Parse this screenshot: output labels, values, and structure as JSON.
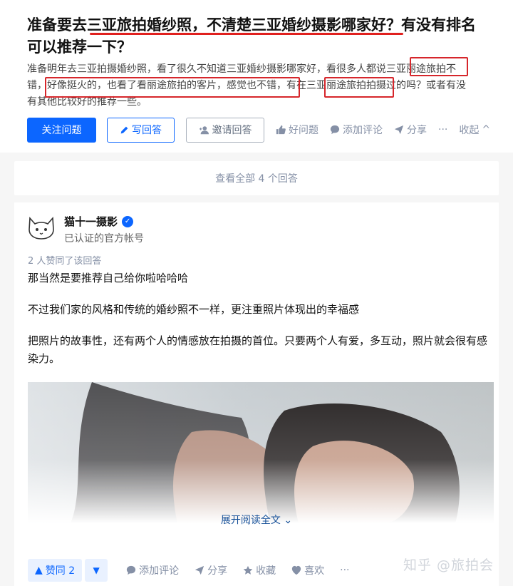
{
  "question": {
    "title_line1": "准备要去三亚旅拍婚纱照，不清楚三亚婚纱摄影哪家好？有没有排名",
    "title_line2": "可以推荐一下？",
    "desc_line1": "准备明年去三亚拍摄婚纱照，看了很久不知道三亚婚纱摄影哪家好，看很多人都说三亚丽途旅拍不",
    "desc_line2": "错，好像挺火的，也看了看丽途旅拍的客片，感觉也不错，有在三亚丽途旅拍拍摄过的吗？或者有没",
    "desc_line3": "有其他比较好的推荐一些。"
  },
  "actions": {
    "follow": "关注问题",
    "write": "写回答",
    "invite": "邀请回答",
    "good": "好问题",
    "comment": "添加评论",
    "share": "分享",
    "more": "···",
    "collapse": "收起"
  },
  "all_answers": "查看全部 4 个回答",
  "answer": {
    "author": "猫十一摄影",
    "bio": "已认证的官方帐号",
    "votes_text": "2 人赞同了该回答",
    "paragraphs": [
      "那当然是要推荐自己给你啦哈哈哈",
      "不过我们家的风格和传统的婚纱照不一样，更注重照片体现出的幸福感",
      "把照片的故事性，还有两个人的情感放在拍摄的首位。只要两个人有爱，多互动，照片就会很有感染力。"
    ],
    "expand": "展开阅读全文"
  },
  "bar": {
    "vote_up": "赞同 2",
    "comment": "添加评论",
    "share": "分享",
    "collect": "收藏",
    "like": "喜欢",
    "more": "···"
  },
  "watermark": "知乎 @旅拍会",
  "colors": {
    "brand": "#0c66ff",
    "highlight": "#d6262b"
  }
}
